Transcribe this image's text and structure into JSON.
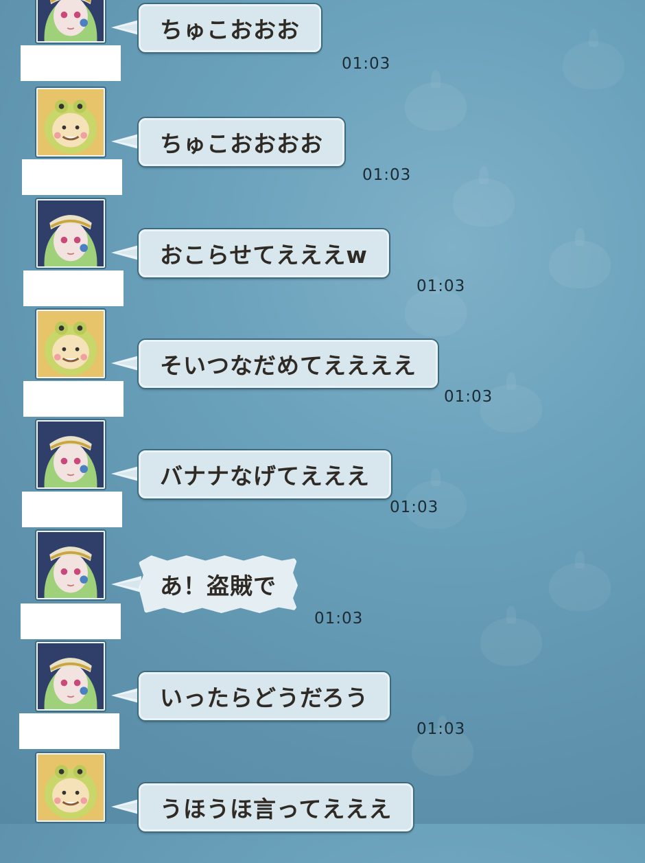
{
  "messages": [
    {
      "text": "ちゅこおおお",
      "time": "01:03",
      "avatar": "elf-girl-avatar-icon"
    },
    {
      "text": "ちゅこおおおお",
      "time": "01:03",
      "avatar": "frog-costume-avatar-icon"
    },
    {
      "text": "おこらせてえええw",
      "time": "01:03",
      "avatar": "elf-girl-avatar-icon"
    },
    {
      "text": "そいつなだめてええええ",
      "time": "01:03",
      "avatar": "frog-costume-avatar-icon"
    },
    {
      "text": "バナナなげてえええ",
      "time": "01:03",
      "avatar": "elf-girl-avatar-icon"
    },
    {
      "text": "あ！盗賊で",
      "time": "01:03",
      "avatar": "elf-girl-avatar-icon",
      "style": "shout"
    },
    {
      "text": "いったらどうだろう",
      "time": "01:03",
      "avatar": "elf-girl-avatar-icon"
    },
    {
      "text": "うほうほ言ってえええ",
      "time": "",
      "avatar": "frog-costume-avatar-icon"
    }
  ],
  "colors": {
    "bubble_fill": "#d8e7ee",
    "bubble_border": "#eaf4f8",
    "background": "#6aa1bb",
    "text": "#2f2a24"
  }
}
